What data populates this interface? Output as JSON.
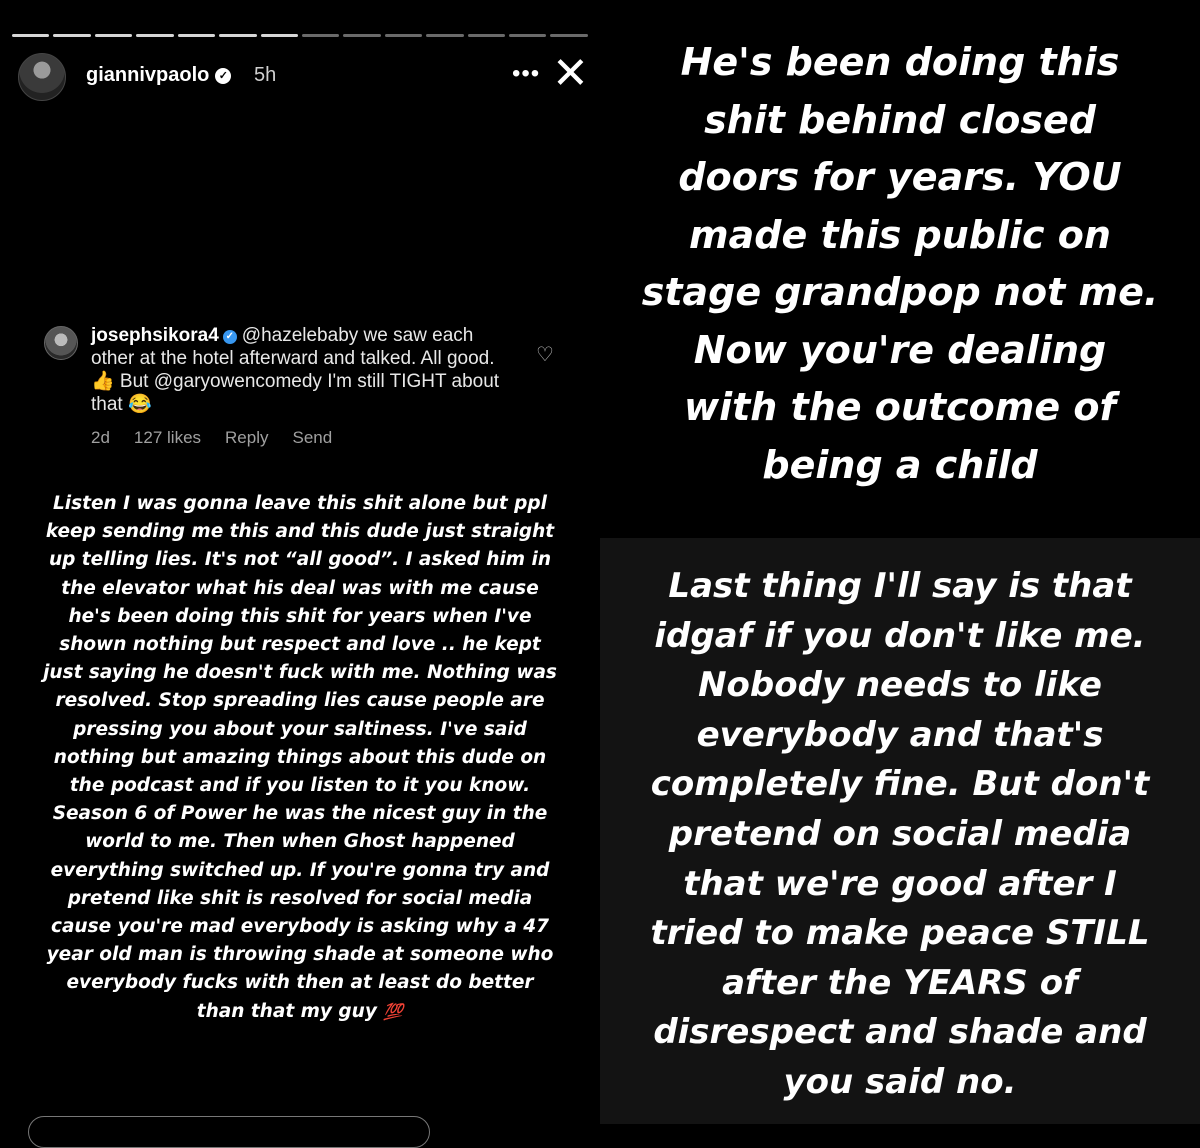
{
  "story": {
    "progress_total": 14,
    "progress_done": 7,
    "username": "giannivpaolo",
    "time": "5h",
    "more_icon": "•••",
    "close_icon": "✕"
  },
  "comment": {
    "username": "josephsikora4",
    "text": "@hazelebaby we saw each other at the hotel afterward and talked. All good. 👍 But @garyowencomedy I'm still TIGHT about that 😂",
    "age": "2d",
    "likes": "127 likes",
    "reply": "Reply",
    "send": "Send"
  },
  "caption": "Listen I was gonna leave this shit alone but ppl keep sending me this and this dude just straight up telling lies. It's not “all good”. I asked him in the elevator what his deal was with me cause he's been doing this shit for years when I've shown nothing but respect and love .. he kept just saying he doesn't fuck with me. Nothing was resolved. Stop spreading lies cause people are pressing you about your saltiness. I've said nothing but amazing things about this dude on the podcast and if you listen to it you know. Season 6 of Power he was the nicest guy in the world to me. Then when Ghost happened everything switched up. If you're gonna try and pretend like shit is resolved for social media cause you're mad everybody is asking why a 47 year old man is throwing shade at someone who everybody fucks with then at least do better than that my guy",
  "caption_emoji": "💯",
  "right_top_lines": [
    "He's been doing this",
    "shit behind closed",
    "doors for years. YOU",
    "made this public on",
    "stage grandpop not me.",
    "Now you're dealing",
    "with the outcome of",
    "being a child"
  ],
  "right_bottom_lines": [
    "Last thing I'll say is that",
    "idgaf if you don't like me.",
    "Nobody needs to like",
    "everybody and that's",
    "completely fine. But don't",
    "pretend on social media",
    "that we're good after I",
    "tried to make peace STILL",
    "after the YEARS of",
    "disrespect and shade and",
    "you said no."
  ],
  "colors": {
    "background": "#000000",
    "text": "#ffffff",
    "emoji_red": "#ff3b30"
  }
}
